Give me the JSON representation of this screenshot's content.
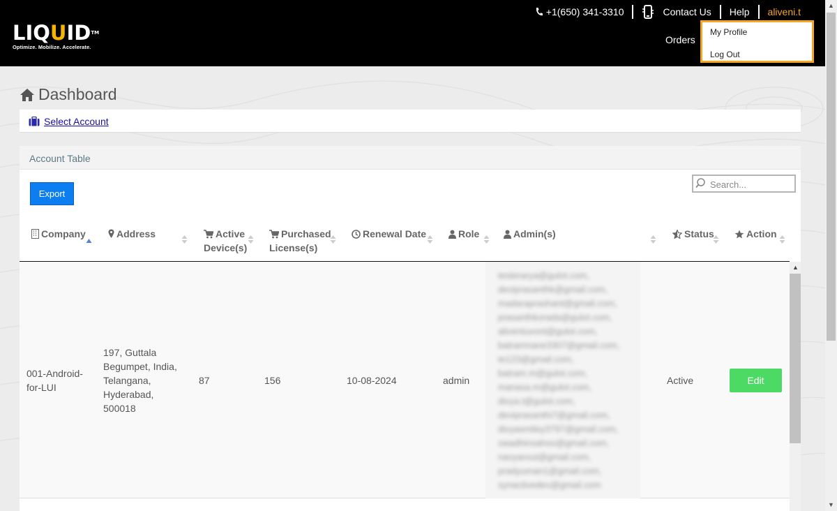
{
  "header": {
    "logo": {
      "word_pre": "LIQ",
      "word_u": "U",
      "word_post": "ID",
      "tm": "TM",
      "tagline": "Optimize. Mobilize. Accelerate."
    },
    "phone": "+1(650) 341-3310",
    "contact": "Contact Us",
    "help": "Help",
    "user": "aliveni.t",
    "orders": "Orders",
    "accent": "#f5a623"
  },
  "dropdown": {
    "items": [
      "My Profile",
      "Log Out"
    ]
  },
  "page": {
    "title": "Dashboard",
    "select_account": "Select Account"
  },
  "panel": {
    "title": "Account Table",
    "export": "Export",
    "search_placeholder": "Search..."
  },
  "table": {
    "columns": {
      "company": "Company",
      "address": "Address",
      "active_devices_1": "Active",
      "active_devices_2": "Device(s)",
      "purchased_1": "Purchased",
      "purchased_2": "License(s)",
      "renewal": "Renewal Date",
      "role": "Role",
      "admins": "Admin(s)",
      "status": "Status",
      "action": "Action"
    },
    "row": {
      "company": [
        "001-Android-",
        "for-LUI"
      ],
      "address": [
        "197, Guttala",
        "Begumpet, India,",
        "Telangana,",
        "Hyderabad,",
        "500018"
      ],
      "active_devices": "87",
      "purchased": "156",
      "renewal": "10-08-2024",
      "role": "admin",
      "admins": [
        "testerarya@gulot.com,",
        "deviprasanthk@gmail.com,",
        "madaraprashant@gmail.com,",
        "prasanthkorada@gulot.com,",
        "aliventuvont@gulot.com,",
        "batramnane3307@gmail.com,",
        "te123@gmail.com,",
        "batram.m@gulot.com,",
        "manasa.m@gulot.com,",
        "divya.t@gulot.com,",
        "deviprasanthi7@gmail.com,",
        "divyasmiley3797@gmail.com,",
        "swadhinsahoo@gmail.com,",
        "navyarout@gmail.com,",
        "pradyuman1@gmail.com,",
        "synactivedev@gmail.com"
      ],
      "status": "Active",
      "action": "Edit"
    }
  }
}
